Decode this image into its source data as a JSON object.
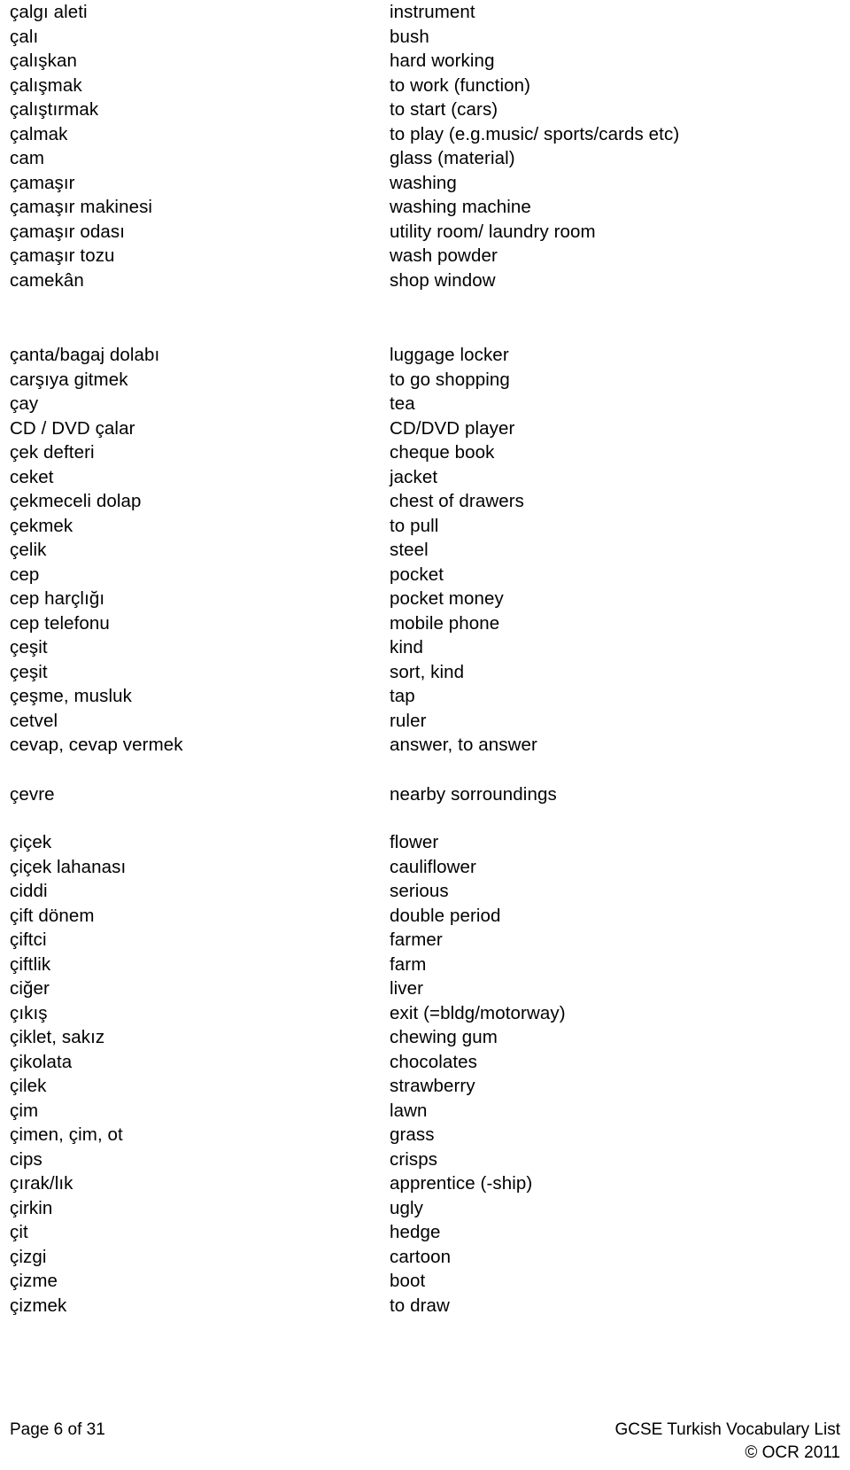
{
  "document": {
    "title": "GCSE Turkish Vocabulary List",
    "copyright": "© OCR 2011",
    "page_label": "Page 6 of 31"
  },
  "blocks": [
    {
      "id": "block-1",
      "entries": [
        {
          "term": "çalgı aleti",
          "definition": "instrument"
        },
        {
          "term": "çalı",
          "definition": "bush"
        },
        {
          "term": "çalışkan",
          "definition": "hard working"
        },
        {
          "term": "çalışmak",
          "definition": "to work (function)"
        },
        {
          "term": "çalıştırmak",
          "definition": "to start (cars)"
        },
        {
          "term": "çalmak",
          "definition": "to play (e.g.music/ sports/cards etc)"
        },
        {
          "term": "cam",
          "definition": "glass (material)"
        },
        {
          "term": "çamaşır",
          "definition": "washing"
        },
        {
          "term": "çamaşır makinesi",
          "definition": "washing machine"
        },
        {
          "term": "çamaşır odası",
          "definition": "utility room/ laundry room"
        },
        {
          "term": "çamaşır tozu",
          "definition": "wash powder"
        },
        {
          "term": "camekân",
          "definition": "shop window"
        }
      ]
    },
    {
      "id": "block-2",
      "entries": [
        {
          "term": "çanta/bagaj dolabı",
          "definition": "luggage locker"
        },
        {
          "term": "carşıya gitmek",
          "definition": "to go shopping"
        },
        {
          "term": "çay",
          "definition": "tea"
        },
        {
          "term": "CD / DVD çalar",
          "definition": "CD/DVD player"
        },
        {
          "term": "çek defteri",
          "definition": "cheque book"
        },
        {
          "term": "ceket",
          "definition": "jacket"
        },
        {
          "term": "çekmeceli dolap",
          "definition": "chest of drawers"
        },
        {
          "term": "çekmek",
          "definition": "to pull"
        },
        {
          "term": "çelik",
          "definition": "steel"
        },
        {
          "term": "cep",
          "definition": "pocket"
        },
        {
          "term": "cep harçlığı",
          "definition": "pocket money"
        },
        {
          "term": "cep telefonu",
          "definition": "mobile phone"
        },
        {
          "term": "çeşit",
          "definition": "kind"
        },
        {
          "term": "çeşit",
          "definition": "sort, kind"
        },
        {
          "term": "çeşme, musluk",
          "definition": "tap"
        },
        {
          "term": "cetvel",
          "definition": "ruler"
        },
        {
          "term": "cevap, cevap vermek",
          "definition": "answer, to answer"
        }
      ]
    },
    {
      "id": "block-3",
      "entries": [
        {
          "term": "çevre",
          "definition": "nearby sorroundings"
        }
      ]
    },
    {
      "id": "block-4",
      "entries": [
        {
          "term": "çiçek",
          "definition": "flower"
        },
        {
          "term": "çiçek lahanası",
          "definition": "cauliflower"
        },
        {
          "term": "ciddi",
          "definition": "serious"
        },
        {
          "term": "çift dönem",
          "definition": "double period"
        },
        {
          "term": "çiftci",
          "definition": "farmer"
        },
        {
          "term": "çiftlik",
          "definition": "farm"
        },
        {
          "term": "ciğer",
          "definition": "liver"
        },
        {
          "term": "çıkış",
          "definition": "exit (=bldg/motorway)"
        },
        {
          "term": "çiklet, sakız",
          "definition": "chewing gum"
        },
        {
          "term": "çikolata",
          "definition": "chocolates"
        },
        {
          "term": "çilek",
          "definition": "strawberry"
        },
        {
          "term": "çim",
          "definition": "lawn"
        },
        {
          "term": "çimen, çim, ot",
          "definition": "grass"
        },
        {
          "term": "cips",
          "definition": "crisps"
        },
        {
          "term": "çırak/lık",
          "definition": "apprentice (-ship)"
        },
        {
          "term": "çirkin",
          "definition": "ugly"
        },
        {
          "term": "çit",
          "definition": "hedge"
        },
        {
          "term": "çizgi",
          "definition": "cartoon"
        },
        {
          "term": "çizme",
          "definition": "boot"
        },
        {
          "term": "çizmek",
          "definition": "to draw"
        }
      ]
    }
  ]
}
